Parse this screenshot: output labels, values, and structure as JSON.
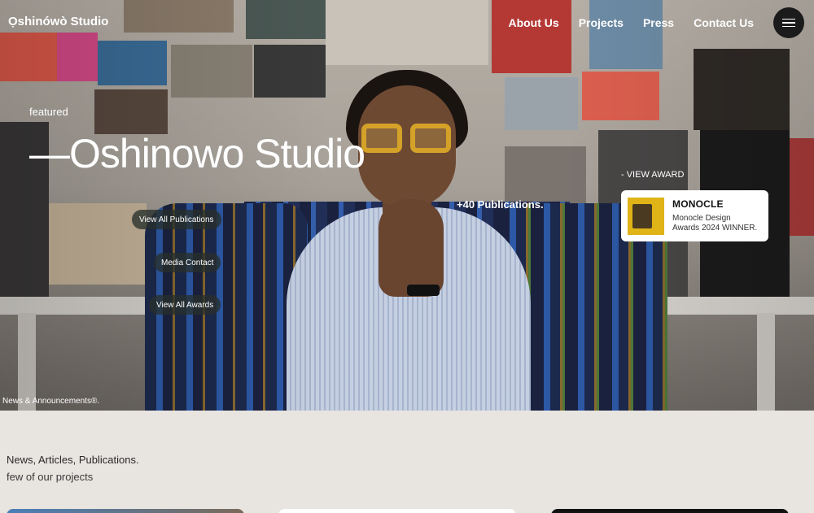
{
  "header": {
    "brand": "Ọshinówò Studio",
    "nav": [
      "About Us",
      "Projects",
      "Press",
      "Contact Us"
    ]
  },
  "hero": {
    "featured_label": "featured",
    "title": "—Oshinowo Studio",
    "publications_count": "+40 Publications.",
    "buttons": {
      "publications": "View All Publications",
      "media": "Media Contact",
      "awards": "View All Awards"
    },
    "view_award_label": "- VIEW AWARD",
    "award": {
      "name": "MONOCLE",
      "line1": "Monocle Design",
      "line2": "Awards 2024 WINNER."
    },
    "news_label": "News & Announcements®."
  },
  "section": {
    "heading": "News, Articles, Publications.",
    "subheading": "few of our projects"
  },
  "colors": {
    "pill_bg": "#28302c",
    "page_bg": "#e8e4e0",
    "menu_btn": "#1b1b1b"
  }
}
